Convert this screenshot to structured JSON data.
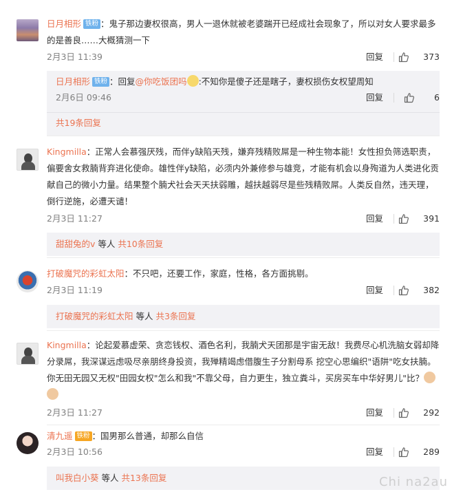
{
  "comments": [
    {
      "user": "日月相形",
      "badge": "铁粉",
      "text": "：鬼子那边妻权很高，男人一退休就被老婆踹开已经成社会现象了，所以对女人要求最多的是善良……大概猜测一下",
      "date": "2月3日 11:39",
      "reply_label": "回复",
      "likes": "373",
      "replies": [
        {
          "user": "日月相形",
          "badge": "铁粉",
          "prefix": "：回复",
          "mention": "@你吃饭团吗",
          "text": ":不知你是傻子还是瞎子，妻权损伤女权望周知",
          "date": "2月6日 09:46",
          "reply_label": "回复",
          "likes": "6"
        }
      ],
      "more": "共19条回复"
    },
    {
      "user": "Kingmilla",
      "text": "：正常人会慕强厌残，而伴y缺陷天残，嫌弃残精败屌是一种生物本能！女性担负筛选职责，偏要舍女救腩背弃进化使命。雄性伴y缺陷，必须内外兼修参与雄竞，才能有机会以身殉道为人类进化贡献自己的微小力量。结果整个腩犬社会天天扶弱雕，越扶越弱尽是些残精败屌。人类反自然，违天理，倒行逆施，必遭天谴！",
      "date": "2月3日 11:27",
      "reply_label": "回复",
      "likes": "391",
      "more_user": "甜甜兔的v",
      "more_mid": " 等人 ",
      "more": "共10条回复"
    },
    {
      "user": "打破魔咒的彩虹太阳",
      "text": "：不只吧，还要工作，家庭，性格，各方面挑剔。",
      "date": "2月3日 11:19",
      "reply_label": "回复",
      "likes": "382",
      "more_user": "打破魔咒的彩虹太阳",
      "more_mid": " 等人 ",
      "more": "共3条回复"
    },
    {
      "user": "Kingmilla",
      "text": "：论起爱慕虚荣、贪恋钱权、酒色名利，我腩犬天团那是宇宙无敌！我费尽心机洗脑女弱却降分录屌，我深谋远虑吸尽亲朋终身投资，我殚精竭虑借腹生子分割母系 挖空心思编织\"语阱\"吃女扶腩。你无田无园又无权\"田园女权\"怎么和我\"不靠父母，自力更生，独立粪斗，买房买车中华好男儿\"比？",
      "date": "2月3日 11:27",
      "reply_label": "回复",
      "likes": "292"
    },
    {
      "user": "清九遥",
      "badge": "铁粉",
      "text": "：国男那么普通，却那么自信",
      "date": "2月3日 10:56",
      "reply_label": "回复",
      "likes": "289",
      "more_user": "叫我白小葵",
      "more_mid": " 等人 ",
      "more": "共13条回复"
    }
  ],
  "watermark": "Chi na2au"
}
